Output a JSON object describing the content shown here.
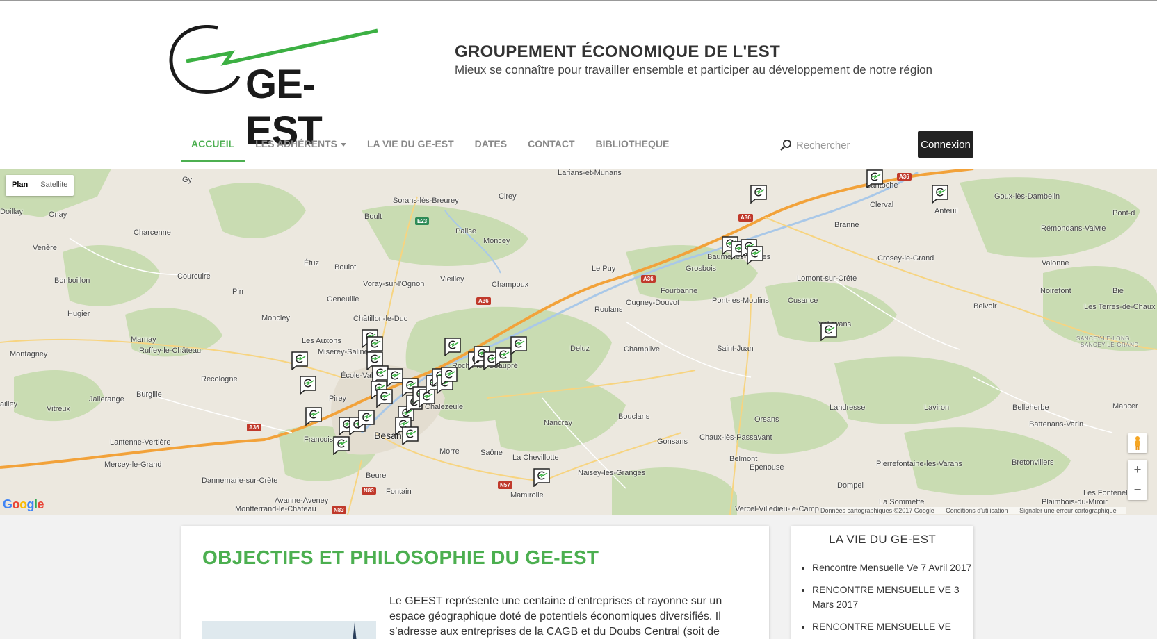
{
  "header": {
    "logo_text": "GE-EST",
    "title": "GROUPEMENT ÉCONOMIQUE DE L'EST",
    "tagline": "Mieux se connaître pour travailler ensemble et participer au développement de notre région"
  },
  "nav": {
    "items": [
      {
        "label": "ACCUEIL",
        "active": true
      },
      {
        "label": "LES ADHÉRENTS",
        "dropdown": true
      },
      {
        "label": "LA VIE DU GE-EST"
      },
      {
        "label": "DATES"
      },
      {
        "label": "CONTACT"
      },
      {
        "label": "BIBLIOTHEQUE"
      }
    ],
    "search_placeholder": "Rechercher",
    "login_label": "Connexion"
  },
  "map": {
    "type_plan": "Plan",
    "type_satellite": "Satellite",
    "google": "Google",
    "footer": {
      "data": "Données cartographiques ©2017 Google",
      "terms": "Conditions d'utilisation",
      "report": "Signaler une erreur cartographique"
    },
    "places": [
      "Gy",
      "Onay",
      "Venère",
      "Bonboillon",
      "Hugier",
      "Marnay",
      "Ruffey-le-Château",
      "Montagney",
      "Vitreux",
      "Jallerange",
      "Lantenne-Vertière",
      "Mercey-le-Grand",
      "Dannemarie-sur-Crète",
      "Avanne-Aveney",
      "Fontain",
      "Beure",
      "Charcenne",
      "Courcuire",
      "Pin",
      "Moncley",
      "Étuz",
      "Boulot",
      "Boult",
      "Geneuille",
      "Les Auxons",
      "Miserey-Salines",
      "École-Valentin",
      "Pirey",
      "Recologne",
      "Burgille",
      "Francois",
      "Sorans-lès-Breurey",
      "Cirey",
      "Palise",
      "Moncey",
      "Voray-sur-l'Ognon",
      "Vieilley",
      "Champoux",
      "Châtillon-le-Duc",
      "Chalezeule",
      "Roche-lez-Beaupré",
      "Besançon",
      "Morre",
      "Saône",
      "La Chevillotte",
      "Mamirolle",
      "Nancray",
      "Bouclans",
      "Champlive",
      "Deluz",
      "Le Puy",
      "Roulans",
      "Ougney-Douvot",
      "Fourbanne",
      "Grosbois",
      "Baume-les-Dames",
      "Pont-les-Moulins",
      "Cusance",
      "Lomont-sur-Crête",
      "Crosey-le-Grand",
      "Branne",
      "Clerval",
      "Santoche",
      "Anteuil",
      "Goux-lès-Dambelin",
      "Rémondans-Vaivre",
      "Valonne",
      "Noirefont",
      "Belvoir",
      "Les Terres-de-Chaux",
      "Vellevans",
      "Saint-Juan",
      "Landresse",
      "Laviron",
      "Belleherbe",
      "Battenans-Varin",
      "Orsans",
      "Chaux-lès-Passavant",
      "Gonsans",
      "Belmont",
      "Épenouse",
      "Pierrefontaine-les-Varans",
      "Bretonvillers",
      "Dompel",
      "La Sommette",
      "Naisey-les-Granges",
      "Larians-et-Munans",
      "Mancer",
      "Les Fontenelles",
      "Plaimbois-du-Miroir",
      "Montferrand-le-Château",
      "Vercel-Villedieu-le-Camp",
      "SANCEY-LE-LONG",
      "SANCEY-LE-GRAND",
      "Pont-d",
      "Bie",
      "Doillay",
      "ailley"
    ],
    "road_labels": [
      "A36",
      "A36",
      "A36",
      "A36",
      "A36",
      "E23",
      "N57",
      "N83",
      "N83"
    ]
  },
  "main": {
    "title": "OBJECTIFS ET PHILOSOPHIE DU GE-EST",
    "intro": "Le GEEST représente une centaine d’entreprises et rayonne sur un espace géographique doté de potentiels économiques diversifiés. Il s’adresse aux entreprises de la CAGB et du Doubs Central (soit de"
  },
  "sidebar": {
    "title": "LA VIE DU GE-EST",
    "items": [
      {
        "label": "Rencontre Mensuelle Ve 7 Avril 2017"
      },
      {
        "label": "RENCONTRE MENSUELLE VE 3 Mars 2017"
      },
      {
        "label": "RENCONTRE MENSUELLE VE"
      }
    ]
  },
  "colors": {
    "accent": "#4caf50",
    "login_bg": "#222222",
    "map_bg": "#ece8df",
    "forest": "#c9dcb2"
  }
}
